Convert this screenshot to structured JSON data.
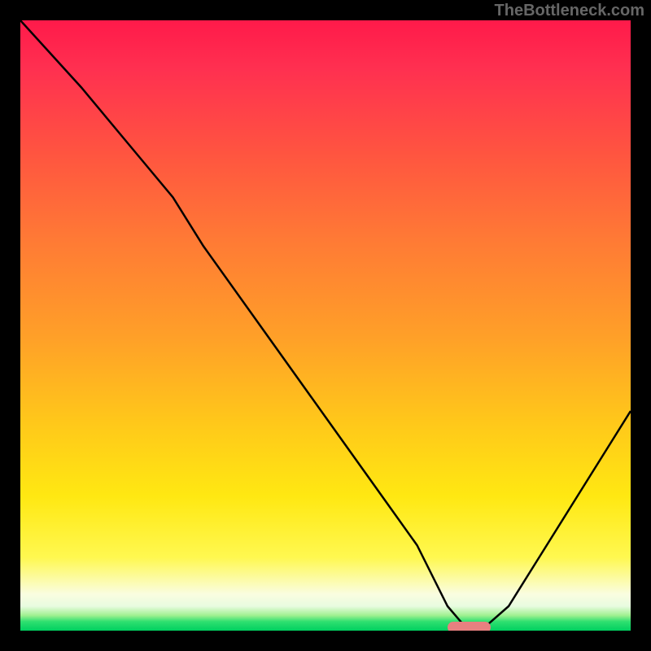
{
  "watermark": "TheBottleneck.com",
  "chart_data": {
    "type": "line",
    "title": "",
    "xlabel": "",
    "ylabel": "",
    "xlim": [
      0,
      100
    ],
    "ylim": [
      0,
      100
    ],
    "series": [
      {
        "name": "bottleneck-curve",
        "x": [
          0,
          10,
          20,
          25,
          30,
          40,
          50,
          60,
          65,
          70,
          73,
          76,
          80,
          85,
          90,
          95,
          100
        ],
        "y": [
          100,
          89,
          77,
          71,
          63,
          49,
          35,
          21,
          14,
          4,
          0.5,
          0.5,
          4,
          12,
          20,
          28,
          36
        ]
      }
    ],
    "marker": {
      "x_start": 70,
      "x_end": 77,
      "y": 0.5
    },
    "gradient_stops": [
      {
        "pos": 0,
        "color": "#ff1a4a"
      },
      {
        "pos": 50,
        "color": "#ffa028"
      },
      {
        "pos": 90,
        "color": "#fff850"
      },
      {
        "pos": 100,
        "color": "#00d060"
      }
    ]
  }
}
